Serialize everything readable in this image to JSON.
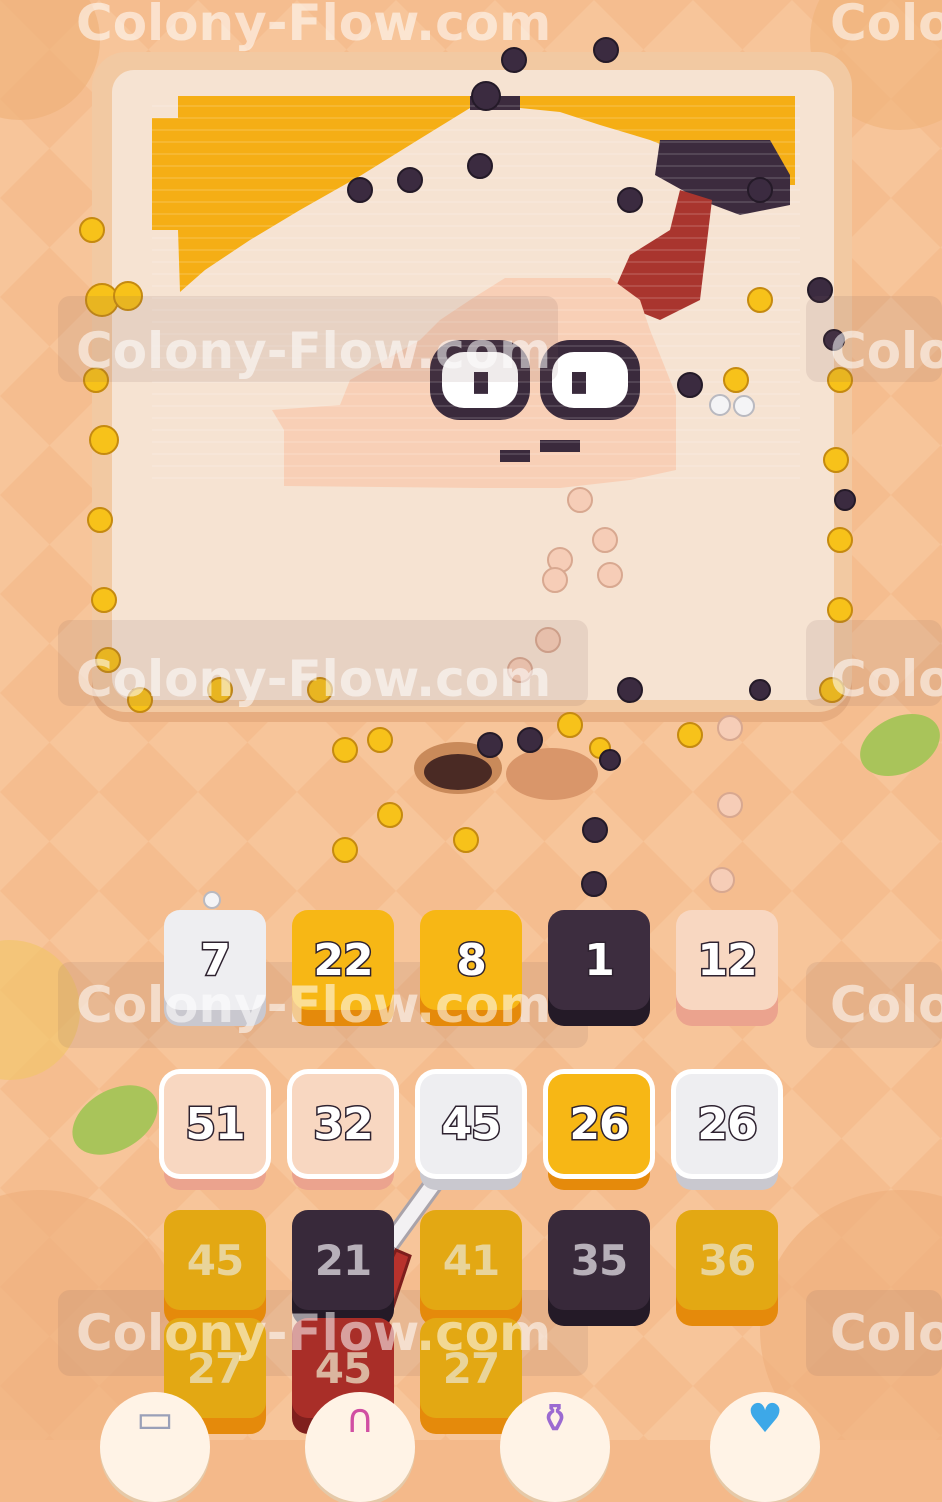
{
  "watermark": {
    "text": "Colony-Flow.com",
    "partial_text": "Colo"
  },
  "colors": {
    "white": "#e9e9ec",
    "yellow": "#f6b314",
    "dark": "#3b2b3c",
    "peach": "#f7d4bc",
    "red": "#b8322c"
  },
  "queue": [
    {
      "value": "7",
      "color": "white"
    },
    {
      "value": "22",
      "color": "yellow"
    },
    {
      "value": "8",
      "color": "yellow"
    },
    {
      "value": "1",
      "color": "dark"
    },
    {
      "value": "12",
      "color": "peach"
    }
  ],
  "grid": [
    [
      {
        "value": "51",
        "color": "peach",
        "state": "active"
      },
      {
        "value": "32",
        "color": "peach",
        "state": "active"
      },
      {
        "value": "45",
        "color": "white",
        "state": "active"
      },
      {
        "value": "26",
        "color": "yellow",
        "state": "active"
      },
      {
        "value": "26",
        "color": "white",
        "state": "active"
      }
    ],
    [
      {
        "value": "45",
        "color": "yellow",
        "state": "locked"
      },
      {
        "value": "21",
        "color": "dark",
        "state": "locked"
      },
      {
        "value": "41",
        "color": "yellow",
        "state": "locked"
      },
      {
        "value": "35",
        "color": "dark",
        "state": "locked"
      },
      {
        "value": "36",
        "color": "yellow",
        "state": "locked"
      }
    ],
    [
      {
        "value": "27",
        "color": "yellow",
        "state": "locked"
      },
      {
        "value": "45",
        "color": "red",
        "state": "locked"
      },
      {
        "value": "27",
        "color": "yellow",
        "state": "locked"
      }
    ]
  ],
  "powerups": [
    "box-icon",
    "magnet-icon",
    "potion-icon",
    "heart-icon"
  ]
}
